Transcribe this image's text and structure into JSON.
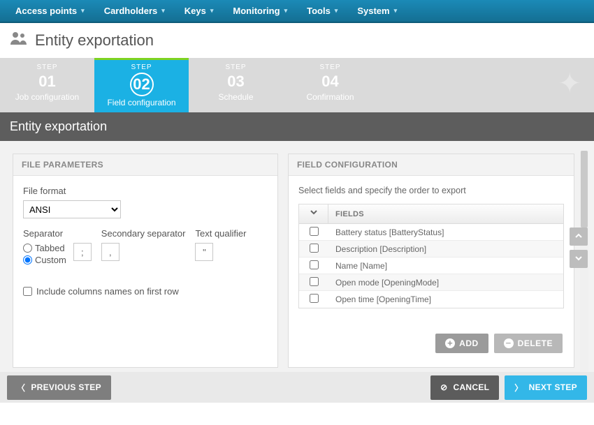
{
  "nav": {
    "items": [
      "Access points",
      "Cardholders",
      "Keys",
      "Monitoring",
      "Tools",
      "System"
    ]
  },
  "page": {
    "title": "Entity exportation"
  },
  "wizard": {
    "step_label": "STEP",
    "steps": [
      {
        "num": "01",
        "name": "Job configuration"
      },
      {
        "num": "02",
        "name": "Field configuration"
      },
      {
        "num": "03",
        "name": "Schedule"
      },
      {
        "num": "04",
        "name": "Confirmation"
      }
    ],
    "active_index": 1
  },
  "section": {
    "heading": "Entity exportation"
  },
  "file_params": {
    "panel_title": "FILE PARAMETERS",
    "file_format_label": "File format",
    "file_format_value": "ANSI",
    "separator_label": "Separator",
    "separator_options": {
      "tabbed": "Tabbed",
      "custom": "Custom"
    },
    "separator_selected": "custom",
    "separator_value": ";",
    "secondary_separator_label": "Secondary separator",
    "secondary_separator_value": ",",
    "text_qualifier_label": "Text qualifier",
    "text_qualifier_value": "\"",
    "include_columns_label": "Include columns names on first row",
    "include_columns_checked": false
  },
  "field_config": {
    "panel_title": "FIELD CONFIGURATION",
    "instructions": "Select fields and specify the order to export",
    "column_header": "FIELDS",
    "rows": [
      {
        "label": "Battery status [BatteryStatus]",
        "checked": false
      },
      {
        "label": "Description [Description]",
        "checked": false
      },
      {
        "label": "Name [Name]",
        "checked": false
      },
      {
        "label": "Open mode [OpeningMode]",
        "checked": false
      },
      {
        "label": "Open time [OpeningTime]",
        "checked": false
      }
    ],
    "add_label": "ADD",
    "delete_label": "DELETE"
  },
  "footer": {
    "previous": "PREVIOUS STEP",
    "cancel": "CANCEL",
    "next": "NEXT STEP"
  }
}
